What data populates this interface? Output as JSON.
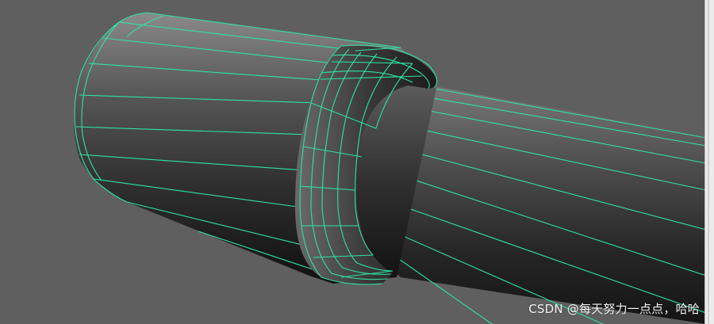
{
  "viewport": {
    "background": "#5f5f5f",
    "wire_color": "#2ee3a0"
  },
  "watermark": {
    "text": "CSDN @每天努力一点点，哈哈"
  }
}
